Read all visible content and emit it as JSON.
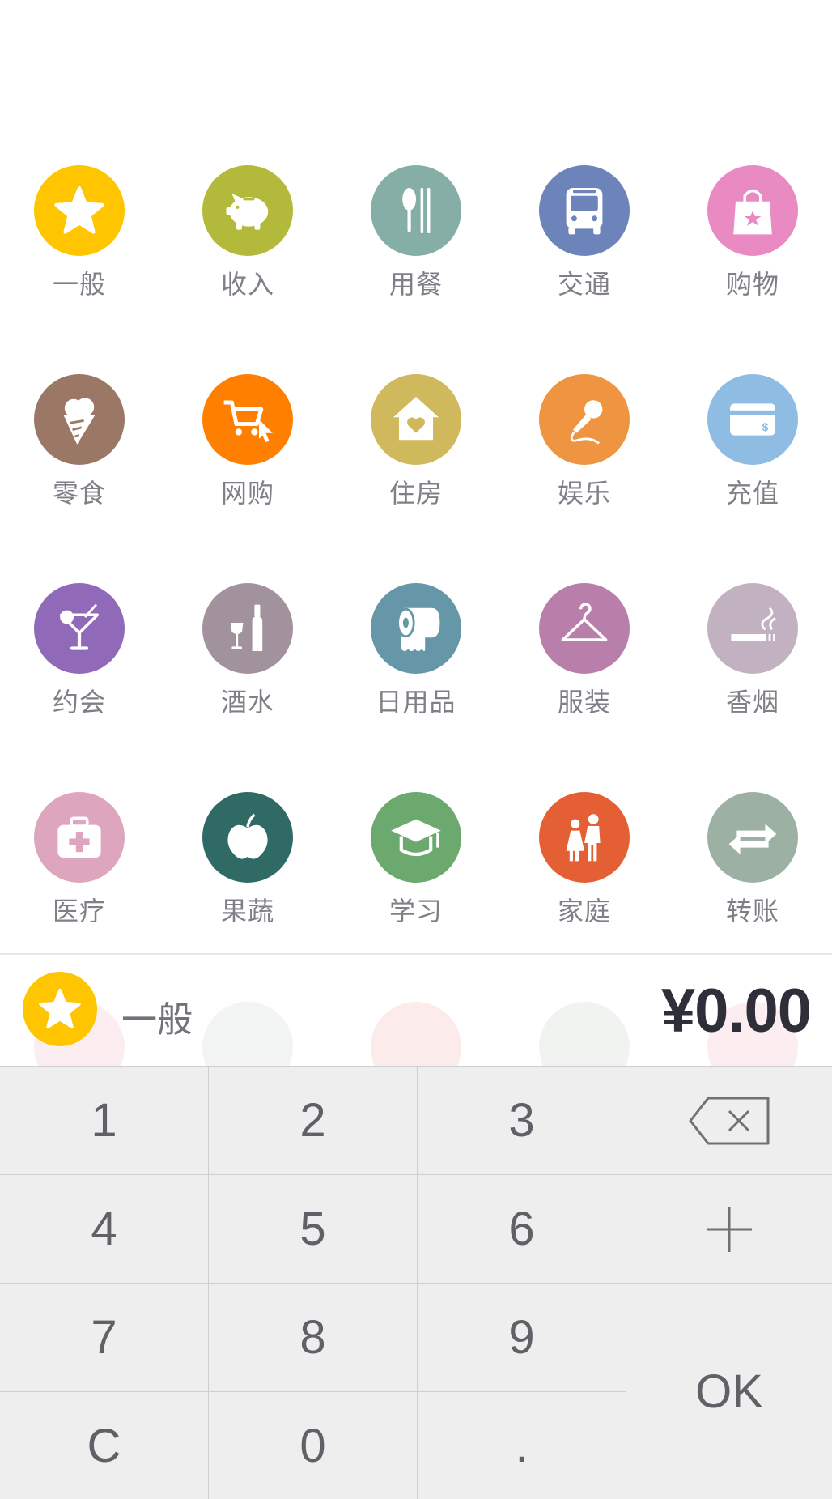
{
  "categories": [
    {
      "label": "一般",
      "color": "#ffc500",
      "icon": "star-icon"
    },
    {
      "label": "收入",
      "color": "#b3b93a",
      "icon": "piggy-bank-icon"
    },
    {
      "label": "用餐",
      "color": "#85aea7",
      "icon": "spoon-chopsticks-icon"
    },
    {
      "label": "交通",
      "color": "#6c84ba",
      "icon": "bus-icon"
    },
    {
      "label": "购物",
      "color": "#ea8ac3",
      "icon": "shopping-bag-icon"
    },
    {
      "label": "零食",
      "color": "#9b7766",
      "icon": "ice-cream-icon"
    },
    {
      "label": "网购",
      "color": "#ff8000",
      "icon": "cart-cursor-icon"
    },
    {
      "label": "住房",
      "color": "#d0b85c",
      "icon": "house-heart-icon"
    },
    {
      "label": "娱乐",
      "color": "#ef9440",
      "icon": "microphone-icon"
    },
    {
      "label": "充值",
      "color": "#8ebce3",
      "icon": "credit-card-icon"
    },
    {
      "label": "约会",
      "color": "#9169b9",
      "icon": "cocktail-icon"
    },
    {
      "label": "酒水",
      "color": "#a2929d",
      "icon": "wine-bottle-icon"
    },
    {
      "label": "日用品",
      "color": "#6597a8",
      "icon": "toilet-paper-icon"
    },
    {
      "label": "服装",
      "color": "#b97fab",
      "icon": "hanger-icon"
    },
    {
      "label": "香烟",
      "color": "#c2b2c1",
      "icon": "cigarette-icon"
    },
    {
      "label": "医疗",
      "color": "#dea5be",
      "icon": "medical-kit-icon"
    },
    {
      "label": "果蔬",
      "color": "#2f6a65",
      "icon": "apple-icon"
    },
    {
      "label": "学习",
      "color": "#6ca96e",
      "icon": "graduation-cap-icon"
    },
    {
      "label": "家庭",
      "color": "#e45f33",
      "icon": "family-icon"
    },
    {
      "label": "转账",
      "color": "#9cb1a3",
      "icon": "transfer-arrows-icon"
    }
  ],
  "faded_row_colors": [
    "#ea6f8a",
    "#9cb1a3",
    "#e45f66",
    "#8fa590",
    "#ea6f8a"
  ],
  "selected": {
    "label": "一般",
    "color": "#ffc500",
    "icon": "star-icon"
  },
  "amount": "¥0.00",
  "keypad": {
    "k1": "1",
    "k2": "2",
    "k3": "3",
    "k4": "4",
    "k5": "5",
    "k6": "6",
    "k7": "7",
    "k8": "8",
    "k9": "9",
    "clear": "C",
    "k0": "0",
    "dot": ".",
    "ok": "OK",
    "backspace_icon": "backspace-icon",
    "plus_icon": "plus-icon"
  }
}
